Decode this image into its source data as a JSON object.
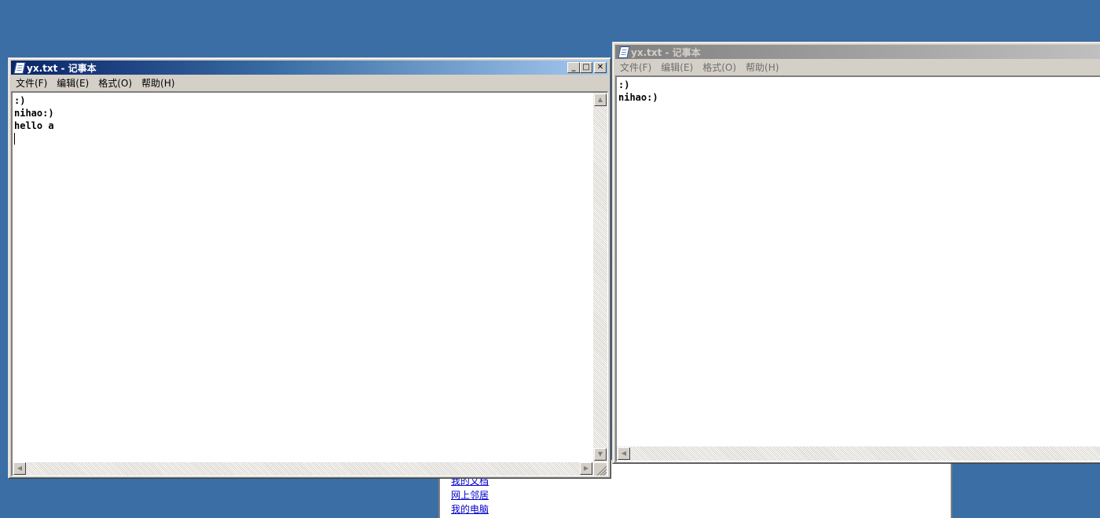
{
  "background_panel": {
    "links": [
      "我的文档",
      "网上邻居",
      "我的电脑"
    ]
  },
  "window_left": {
    "title": "yx.txt - 记事本",
    "state": "active",
    "buttons": {
      "minimize": "_",
      "maximize": "□",
      "close": "✕"
    },
    "menu": [
      "文件(F)",
      "编辑(E)",
      "格式(O)",
      "帮助(H)"
    ],
    "lines": [
      ":)",
      "nihao:)",
      "hello a"
    ]
  },
  "window_right": {
    "title": "yx.txt - 记事本",
    "state": "inactive",
    "menu": [
      "文件(F)",
      "编辑(E)",
      "格式(O)",
      "帮助(H)"
    ],
    "lines": [
      ":)",
      "nihao:)"
    ]
  },
  "icons": {
    "app": "notepad-icon",
    "scroll_up": "up-arrow-icon",
    "scroll_down": "down-arrow-icon",
    "scroll_left": "left-arrow-icon",
    "scroll_right": "right-arrow-icon"
  },
  "colors": {
    "desktop": "#3a6ea5",
    "active_title": "#0a246a",
    "inactive_title": "#808080",
    "chrome": "#d4d0c8"
  }
}
